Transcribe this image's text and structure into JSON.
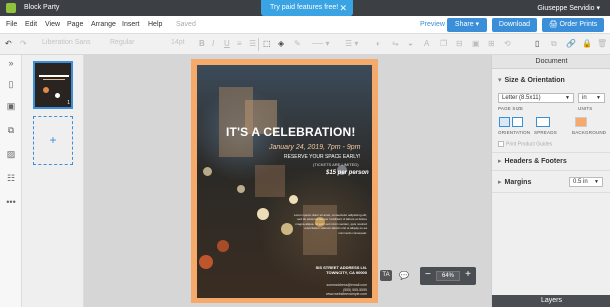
{
  "titlebar": {
    "doc_title": "Block Party",
    "promo": "Try paid features free!",
    "promo_close": "✕",
    "user": "Giuseppe Servidio ▾"
  },
  "menubar": {
    "items": [
      "File",
      "Edit",
      "View",
      "Page",
      "Arrange",
      "Insert",
      "Help"
    ],
    "saved": "Saved",
    "preview": "Preview",
    "share": "Share ▾",
    "download": "Download",
    "order_prints": "Order Prints"
  },
  "toolbar": {
    "font_family": "Liberation Sans",
    "font_style": "Regular",
    "font_size": "14pt"
  },
  "poster": {
    "title": "IT'S A CELEBRATION!",
    "date": "January 24, 2019, 7pm - 9pm",
    "reserve": "RESERVE YOUR SPACE EARLY!",
    "limited": "(TICKETS ARE LIMITED)",
    "price": "$15 per person",
    "body": "Lorem ipsum dolor sit amet, consectetur adipiscing elit, sed do eiusmod tempor incididunt ut labore et dolore magna aliqua. Ut enim ad minim veniam, quis nostrud exercitation ullamco laboris nisi ut aliquip ex ea commodo consequat.",
    "address_line1": "SIS STREET ADDRESS LN.",
    "address_line2": "TOWNCITY, CA 90000",
    "contact1": "someaddress@email.com",
    "contact2": "(555) 555-5555",
    "contact3": "www.websiteexample.com",
    "colors": {
      "frame": "#f5a96b",
      "accent": "#f3caa2"
    }
  },
  "pages_panel": {
    "page_number": "1",
    "add_page": "+"
  },
  "canvas_controls": {
    "zoom_level": "64%",
    "zoom_out": "−",
    "zoom_in": "+"
  },
  "props": {
    "heading": "Document",
    "size_orientation": "Size & Orientation",
    "page_size_value": "Letter (8.5x11)",
    "page_size_label": "PAGE SIZE",
    "units_value": "in",
    "units_label": "UNITS",
    "orientation_label": "ORIENTATION",
    "spreads_label": "SPREADS",
    "background_label": "BACKGROUND",
    "print_guides": "Print Product Guides",
    "headers_footers": "Headers & Footers",
    "margins": "Margins",
    "margins_value": "0.5 in",
    "layers": "Layers"
  },
  "accent_color": "#3a8fd8"
}
